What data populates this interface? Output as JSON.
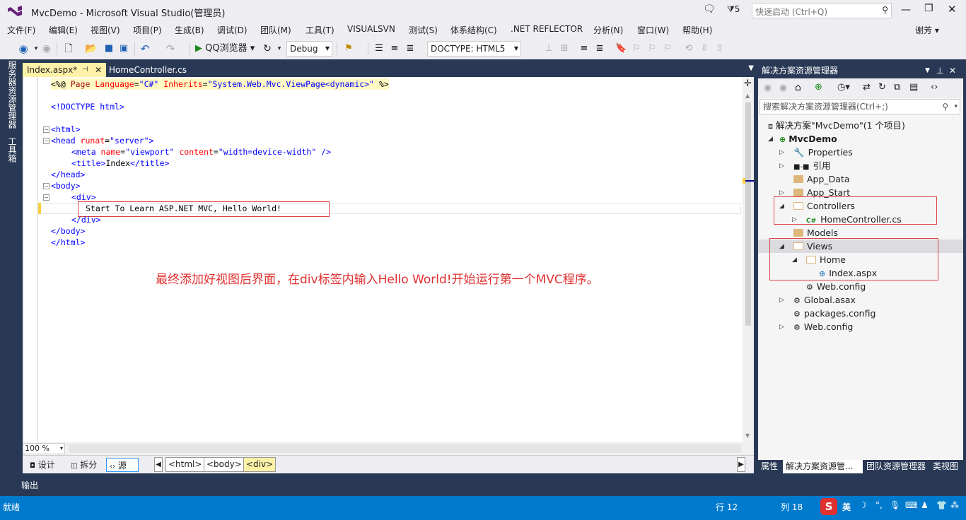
{
  "window": {
    "title": "MvcDemo - Microsoft Visual Studio(管理员)",
    "notify_count": "5",
    "quick_launch_placeholder": "快速启动 (Ctrl+Q)",
    "user": "谢芳"
  },
  "menu": [
    "文件(F)",
    "编辑(E)",
    "视图(V)",
    "项目(P)",
    "生成(B)",
    "调试(D)",
    "团队(M)",
    "工具(T)",
    "VISUALSVN",
    "测试(S)",
    "体系结构(C)",
    ".NET REFLECTOR",
    "分析(N)",
    "窗口(W)",
    "帮助(H)"
  ],
  "toolbar": {
    "run_label": "QQ浏览器",
    "config": "Debug",
    "doctype": "DOCTYPE:  HTML5"
  },
  "left_strip": {
    "server_explorer": "服务器资源管理器",
    "toolbox": "工具箱"
  },
  "tabs": [
    {
      "label": "Index.aspx*",
      "active": true
    },
    {
      "label": "HomeController.cs",
      "active": false
    }
  ],
  "code": {
    "l1_a": "<%@",
    " l1_b": "",
    "l1_page": " Page ",
    "l1_attr1": "Language",
    "l1_v1": "\"C#\"",
    "l1_attr2": " Inherits",
    "l1_v2": "\"System.Web.Mvc.ViewPage<dynamic>\"",
    "l1_end": "%>",
    "l2": "<!DOCTYPE html>",
    "l3": "<html>",
    "l4_tag": "<head",
    "l4_attr": " runat",
    "l4_val": "\"server\"",
    "l4_close": ">",
    "l5_tag": "<meta",
    "l5_a1": " name",
    "l5_v1": "\"viewport\"",
    "l5_a2": " content",
    "l5_v2": "\"width=device-width\"",
    "l5_close": " />",
    "l6_open": "<title>",
    "l6_text": "Index",
    "l6_close": "</title>",
    "l7": "</head>",
    "l8": "<body>",
    "l9": "<div>",
    "l10": "Start To Learn ASP.NET MVC, Hello World!",
    "l11": "</div>",
    "l12": "</body>",
    "l13": "</html>"
  },
  "annotation": "最终添加好视图后界面，在div标签内输入Hello World!开始运行第一个MVC程序。",
  "zoom": "100 %",
  "design_bar": {
    "design": "设计",
    "split": "拆分",
    "source": "源",
    "crumbs": [
      "<html>",
      "<body>",
      "<div>"
    ]
  },
  "output_label": "输出",
  "solution_explorer": {
    "title": "解决方案资源管理器",
    "search_placeholder": "搜索解决方案资源管理器(Ctrl+;)",
    "items": [
      "解决方案\"MvcDemo\"(1 个项目)",
      "MvcDemo",
      "Properties",
      "引用",
      "App_Data",
      "App_Start",
      "Controllers",
      "HomeController.cs",
      "Models",
      "Views",
      "Home",
      "Index.aspx",
      "Web.config",
      "Global.asax",
      "packages.config",
      "Web.config"
    ],
    "bottom_tabs": [
      "属性",
      "解决方案资源管...",
      "团队资源管理器",
      "类视图"
    ]
  },
  "status": {
    "ready": "就绪",
    "row": "行 12",
    "col": "列 18",
    "ime": "英"
  }
}
